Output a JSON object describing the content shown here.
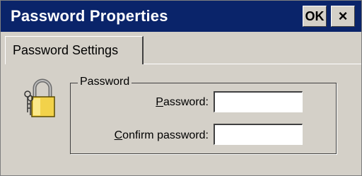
{
  "window": {
    "title": "Password Properties",
    "ok_label": "OK",
    "close_label": "×"
  },
  "tabs": [
    {
      "label": "Password Settings",
      "active": true
    }
  ],
  "group": {
    "legend": "Password",
    "password_label_accel": "P",
    "password_label_rest": "assword:",
    "password_value": "",
    "confirm_label_accel": "C",
    "confirm_label_rest": "onfirm password:",
    "confirm_value": ""
  },
  "icons": {
    "lock": "padlock-with-keys-icon"
  },
  "colors": {
    "titlebar": "#0a246a",
    "face": "#d4d0c8"
  }
}
